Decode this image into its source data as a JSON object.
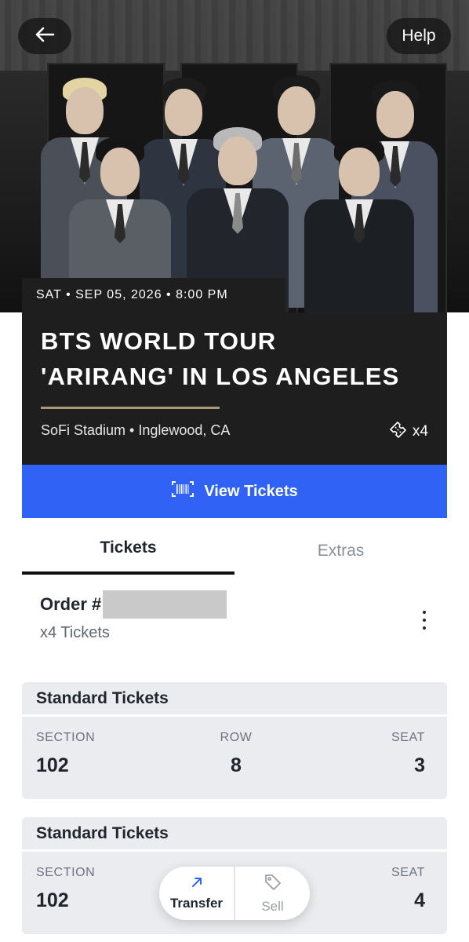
{
  "header": {
    "help_label": "Help",
    "back_icon": "arrow-left-icon"
  },
  "event": {
    "date_line": "SAT • SEP 05, 2026 • 8:00 PM",
    "title_line1": "BTS WORLD TOUR",
    "title_line2": "'ARIRANG' IN LOS ANGELES",
    "venue": "SoFi Stadium • Inglewood, CA",
    "ticket_count": "x4"
  },
  "actions": {
    "view_tickets_label": "View Tickets"
  },
  "tabs": [
    {
      "label": "Tickets",
      "active": true
    },
    {
      "label": "Extras",
      "active": false
    }
  ],
  "order": {
    "label": "Order #",
    "count_label": "x4 Tickets"
  },
  "tickets": [
    {
      "type": "Standard Tickets",
      "section_label": "SECTION",
      "section": "102",
      "row_label": "ROW",
      "row": "8",
      "seat_label": "SEAT",
      "seat": "3"
    },
    {
      "type": "Standard Tickets",
      "section_label": "SECTION",
      "section": "102",
      "seat_label": "SEAT",
      "seat": "4"
    }
  ],
  "floating_actions": {
    "transfer_label": "Transfer",
    "sell_label": "Sell"
  },
  "colors": {
    "accent": "#2f62f5",
    "card_dark": "#1e1e1e",
    "gold_rule": "#a8987a",
    "ticket_bg": "#ebecef"
  }
}
